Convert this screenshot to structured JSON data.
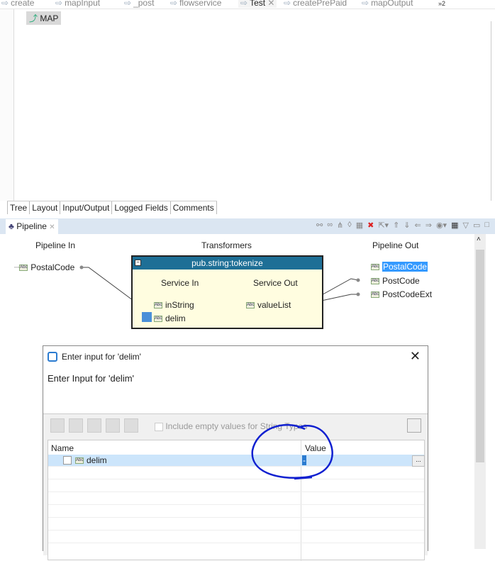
{
  "editor_tabs": [
    {
      "label": "create"
    },
    {
      "label": "mapInput"
    },
    {
      "label": "_post"
    },
    {
      "label": "flowservice"
    },
    {
      "label": "Test",
      "active": true
    },
    {
      "label": "createPrePaid"
    },
    {
      "label": "mapOutput"
    }
  ],
  "overflow_count": "2",
  "flow_step": "MAP",
  "view_tabs": [
    "Tree",
    "Layout",
    "Input/Output",
    "Logged Fields",
    "Comments"
  ],
  "pipeline": {
    "title": "Pipeline",
    "in_header": "Pipeline In",
    "transformers_header": "Transformers",
    "out_header": "Pipeline Out",
    "in_fields": [
      "PostalCode"
    ],
    "service": "pub.string:tokenize",
    "service_in": "Service In",
    "service_out": "Service Out",
    "service_in_fields": [
      "inString",
      "delim"
    ],
    "service_out_fields": [
      "valueList"
    ],
    "out_fields": [
      "PostalCode",
      "PostCode",
      "PostCodeExt"
    ]
  },
  "dialog": {
    "title": "Enter input for 'delim'",
    "heading": "Enter Input for 'delim'",
    "include_empty": "Include empty values for String Types",
    "col_name": "Name",
    "col_value": "Value",
    "row_name": "delim",
    "row_value": "-",
    "ellipsis": "..."
  },
  "colors": {
    "annotation": "#1020d0",
    "service_header": "#1e6f96",
    "selection": "#3399ff"
  }
}
